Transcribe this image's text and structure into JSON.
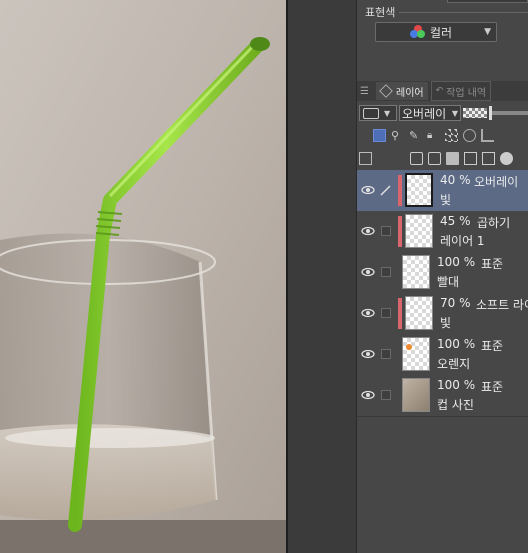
{
  "color_section": {
    "label": "표현색",
    "value": "컬러"
  },
  "tabs": [
    {
      "label": "레이어"
    },
    {
      "label": "작업 내역"
    }
  ],
  "blend_mode": {
    "value": "오버레이"
  },
  "layers": [
    {
      "percent": "40 %",
      "mode": "오버레이",
      "name": "빛",
      "selected": true,
      "color_bar": true,
      "edit": true
    },
    {
      "percent": "45 %",
      "mode": "곱하기",
      "name": "레이어 1",
      "selected": false,
      "color_bar": true,
      "edit": false
    },
    {
      "percent": "100 %",
      "mode": "표준",
      "name": "빨대",
      "selected": false,
      "color_bar": false,
      "edit": false
    },
    {
      "percent": "70 %",
      "mode": "소프트 라이트",
      "name": "빛",
      "selected": false,
      "color_bar": true,
      "edit": false
    },
    {
      "percent": "100 %",
      "mode": "표준",
      "name": "오렌지",
      "selected": false,
      "color_bar": false,
      "edit": false
    },
    {
      "percent": "100 %",
      "mode": "표준",
      "name": "컵 사진",
      "selected": false,
      "color_bar": false,
      "edit": false
    }
  ],
  "colors": {
    "straw": "#8fd62b",
    "selected_layer": "#5c6a86",
    "color_bar": "#d9666d"
  }
}
